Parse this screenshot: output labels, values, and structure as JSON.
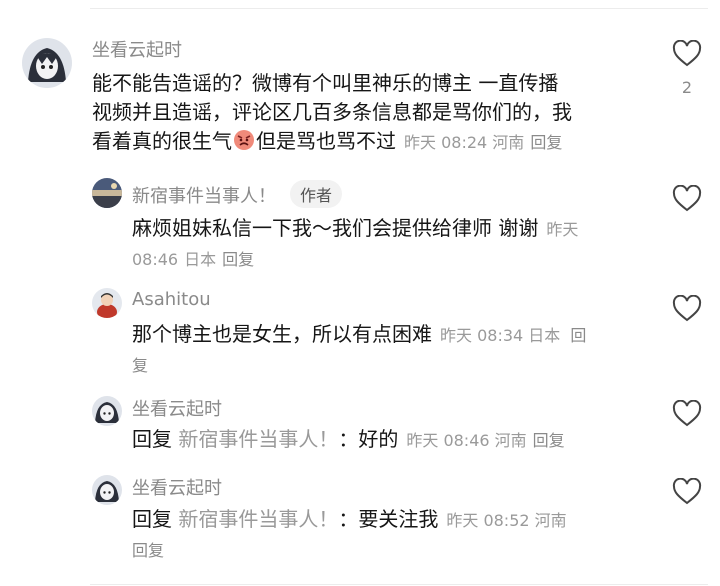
{
  "comments": [
    {
      "username": "坐看云起时",
      "lines": [
        "能不能告造谣的？微博有个叫里神乐的博主 一直传播",
        "视频并且造谣，评论区几百多条信息都是骂你们的，我"
      ],
      "line3_a": "看着真的很生气",
      "emoji_icon": "angry-face-emoji",
      "line3_b": "但是骂也骂不过",
      "time": "昨天 08:24",
      "location": "河南",
      "reply_label": "回复",
      "like_count": "2"
    }
  ],
  "replies": [
    {
      "username": "新宿事件当事人！",
      "author_tag": "作者",
      "text_line1": "麻烦姐妹私信一下我～我们会提供给律师 谢谢",
      "meta_line1": "昨天",
      "meta_line2_time": "08:46",
      "location": "日本",
      "reply_label": "回复"
    },
    {
      "username": "Asahitou",
      "text": "那个博主也是女生，所以有点困难",
      "time": "昨天 08:34",
      "location": "日本",
      "reply_label_a": "回",
      "reply_label_b": "复"
    },
    {
      "username": "坐看云起时",
      "reply_prefix": "回复",
      "target": "新宿事件当事人！",
      "colon": "：",
      "text": "好的",
      "time": "昨天 08:46",
      "location": "河南",
      "reply_label": "回复"
    },
    {
      "username": "坐看云起时",
      "reply_prefix": "回复",
      "target": "新宿事件当事人！",
      "colon": "：",
      "text": "要关注我",
      "time": "昨天 08:52",
      "location": "河南",
      "reply_label": "回复"
    }
  ],
  "icons": {
    "like": "heart-outline-icon"
  },
  "colors": {
    "meta": "#9a9a9a",
    "text": "#161616",
    "name": "#8a8a8a"
  }
}
